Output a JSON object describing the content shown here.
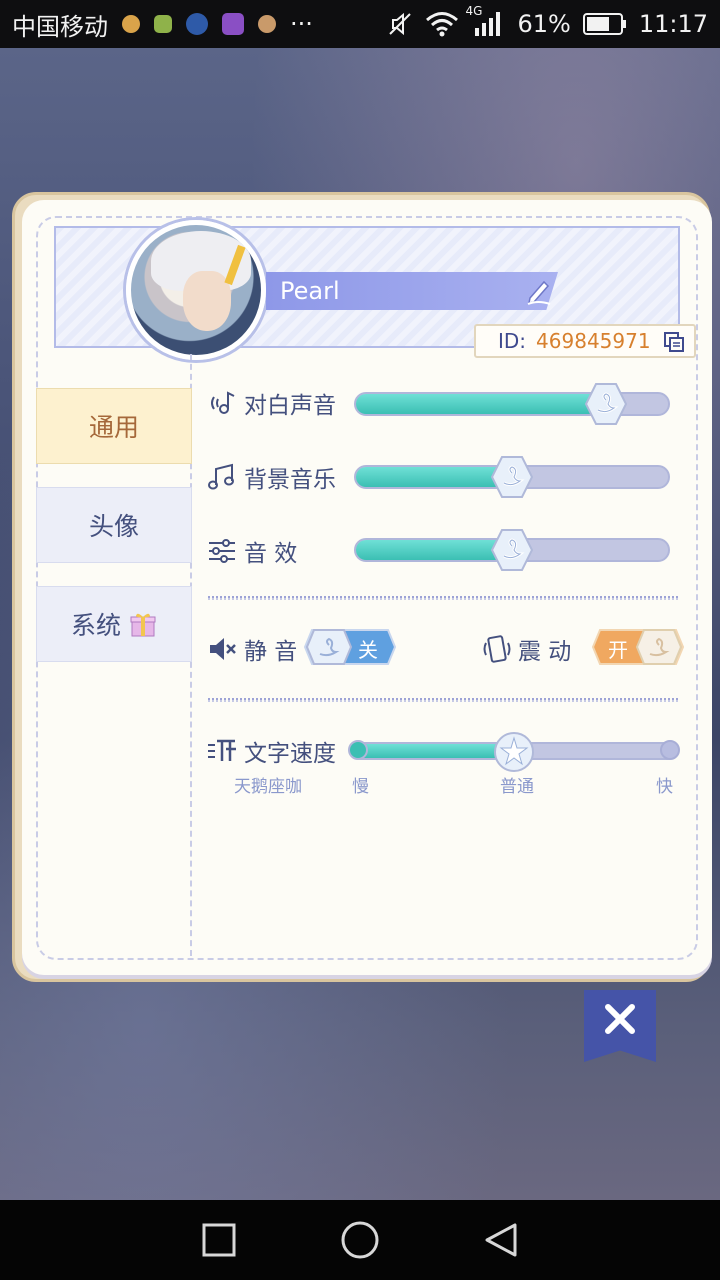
{
  "status_bar": {
    "carrier": "中国移动",
    "network": "4G",
    "battery": "61%",
    "time": "11:17",
    "more": "···"
  },
  "profile": {
    "name": "Pearl",
    "id_label": "ID:",
    "id_value": "469845971"
  },
  "tabs": [
    {
      "label": "通用",
      "active": true
    },
    {
      "label": "头像",
      "active": false
    },
    {
      "label": "系统",
      "active": false
    }
  ],
  "settings": {
    "dialogue_volume": {
      "label": "对白声音",
      "level": 0.8
    },
    "bgm_volume": {
      "label": "背景音乐",
      "level": 0.5
    },
    "sfx_volume": {
      "label": "音 效",
      "level": 0.5
    },
    "mute": {
      "label": "静 音",
      "state": "关"
    },
    "vibration": {
      "label": "震 动",
      "state": "开"
    },
    "text_speed": {
      "label": "文字速度",
      "level": 0.5,
      "sample": "天鹅座咖",
      "slow": "慢",
      "normal": "普通",
      "fast": "快"
    }
  },
  "colors": {
    "accent": "#4554a8",
    "fill": "#3bbfb3",
    "active_tab": "#fdf1cf",
    "id_value": "#d7802e"
  },
  "icons": {
    "close": "close-icon",
    "edit": "pencil-icon",
    "copy": "copy-icon"
  }
}
